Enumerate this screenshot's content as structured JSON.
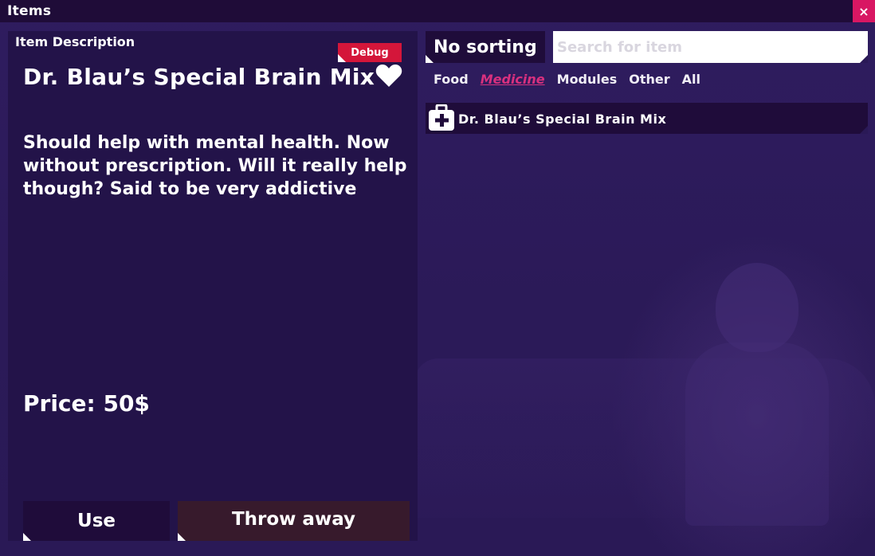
{
  "window": {
    "title": "Items",
    "close_label": "×"
  },
  "description_panel": {
    "header": "Item Description",
    "debug_badge": "Debug",
    "item_name": "Dr. Blau’s Special Brain Mix",
    "description": "Should help with mental health. Now without prescription. Will it really help though? Said to be very addictive",
    "price": "Price: 50$",
    "favorite_icon": "heart-icon",
    "use_label": "Use",
    "throw_label": "Throw away"
  },
  "list_panel": {
    "sort_label": "No sorting",
    "search": {
      "placeholder": "Search for item",
      "value": ""
    },
    "tabs": [
      {
        "label": "Food",
        "active": false
      },
      {
        "label": "Medicine",
        "active": true
      },
      {
        "label": "Modules",
        "active": false
      },
      {
        "label": "Other",
        "active": false
      },
      {
        "label": "All",
        "active": false
      }
    ],
    "items": [
      {
        "label": "Dr. Blau’s Special Brain Mix",
        "icon": "medkit-icon"
      }
    ]
  },
  "colors": {
    "accent": "#d8307e",
    "close": "#d81763",
    "debug": "#d4163a",
    "panel": "#1f0c3a",
    "background": "#2a1956"
  }
}
